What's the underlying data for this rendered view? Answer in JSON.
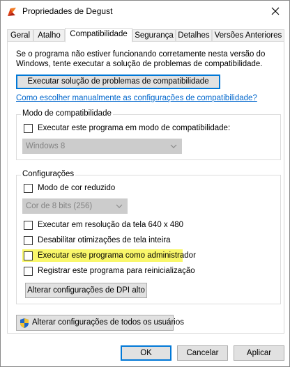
{
  "window": {
    "title": "Propriedades de Degust",
    "icons": {
      "app": "app-icon",
      "close": "close-icon"
    }
  },
  "tabs": [
    {
      "label": "Geral",
      "active": false
    },
    {
      "label": "Atalho",
      "active": false
    },
    {
      "label": "Compatibilidade",
      "active": true
    },
    {
      "label": "Segurança",
      "active": false
    },
    {
      "label": "Detalhes",
      "active": false
    },
    {
      "label": "Versões Anteriores",
      "active": false
    }
  ],
  "intro": {
    "text": "Se o programa não estiver funcionando corretamente nesta versão do Windows, tente executar a solução de problemas de compatibilidade.",
    "troubleshoot_button": "Executar solução de problemas de compatibilidade",
    "manual_link": "Como escolher manualmente as configurações de compatibilidade?"
  },
  "compat_mode": {
    "legend": "Modo de compatibilidade",
    "checkbox_label": "Executar este programa em modo de compatibilidade:",
    "checked": false,
    "select_value": "Windows 8"
  },
  "settings": {
    "legend": "Configurações",
    "reduced_color": {
      "label": "Modo de cor reduzido",
      "checked": false
    },
    "color_select_value": "Cor de 8 bits (256)",
    "res_640": {
      "label": "Executar em resolução da tela 640 x 480",
      "checked": false
    },
    "disable_fullscreen": {
      "label": "Desabilitar otimizações de tela inteira",
      "checked": false
    },
    "run_as_admin": {
      "label": "Executar este programa como administrador",
      "checked": false,
      "highlight_color": "#f9f76a"
    },
    "register_restart": {
      "label": "Registrar este programa para reinicialização",
      "checked": false
    },
    "dpi_button": "Alterar configurações de DPI alto"
  },
  "all_users_button": {
    "label": "Alterar configurações de todos os usuários",
    "icon": "shield-icon"
  },
  "footer": {
    "ok": "OK",
    "cancel": "Cancelar",
    "apply": "Aplicar"
  },
  "colors": {
    "link": "#0066cc",
    "accent": "#0078d7",
    "disabled_combo": "#cccccc"
  }
}
